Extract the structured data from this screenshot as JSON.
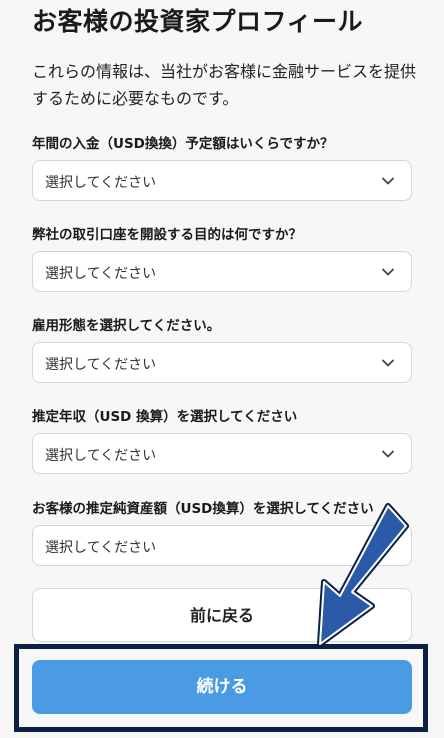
{
  "page": {
    "title": "お客様の投資家プロフィール",
    "description": "これらの情報は、当社がお客様に金融サービスを提供するために必要なものです。"
  },
  "questions": [
    {
      "label": "年間の入金（USD換換）予定額はいくらですか？",
      "value": "選択してください",
      "icon": "chevron-down-icon"
    },
    {
      "label": "弊社の取引口座を開設する目的は何ですか？",
      "value": "選択してください",
      "icon": "chevron-down-icon"
    },
    {
      "label": "雇用形態を選択してください。",
      "value": "選択してください",
      "icon": "chevron-down-icon"
    },
    {
      "label": "推定年収（USD 換算）を選択してください",
      "value": "選択してください",
      "icon": "chevron-down-icon"
    },
    {
      "label": "お客様の推定純資産額（USD換算）を選択してください",
      "value": "選択してください",
      "icon": "chevron-down-icon"
    }
  ],
  "buttons": {
    "back_label": "前に戻る",
    "continue_label": "続ける"
  },
  "colors": {
    "primary": "#4a9ae4",
    "annotation": "#0c1f44",
    "arrow_fill": "#2a5aa8"
  }
}
